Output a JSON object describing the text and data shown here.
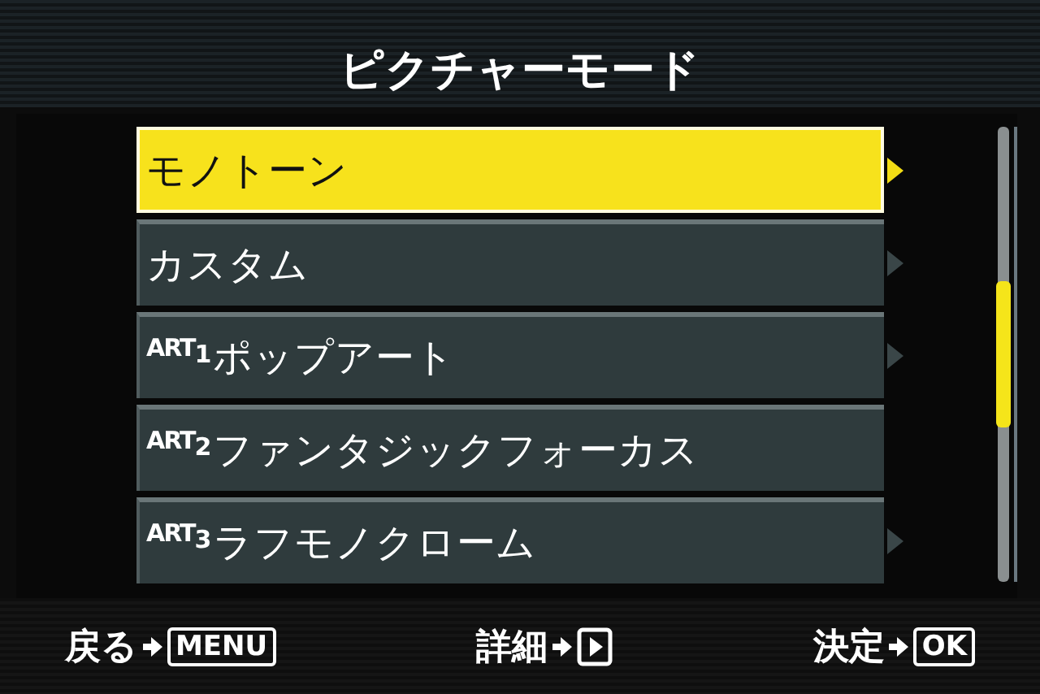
{
  "title": "ピクチャーモード",
  "items": [
    {
      "label": "モノトーン",
      "selected": true,
      "has_submenu": true
    },
    {
      "label": "カスタム",
      "selected": false,
      "has_submenu": true
    },
    {
      "badge": {
        "text": "ART",
        "index": "1"
      },
      "label": "ポップアート",
      "selected": false,
      "has_submenu": true
    },
    {
      "badge": {
        "text": "ART",
        "index": "2"
      },
      "label": "ファンタジックフォーカス",
      "selected": false,
      "has_submenu": false
    },
    {
      "badge": {
        "text": "ART",
        "index": "3"
      },
      "label": "ラフモノクローム",
      "selected": false,
      "has_submenu": true
    }
  ],
  "footer": [
    {
      "label": "戻る",
      "key": {
        "kind": "text",
        "text": "MENU"
      }
    },
    {
      "label": "詳細",
      "key": {
        "kind": "play"
      }
    },
    {
      "label": "決定",
      "key": {
        "kind": "text",
        "text": "OK"
      }
    }
  ]
}
